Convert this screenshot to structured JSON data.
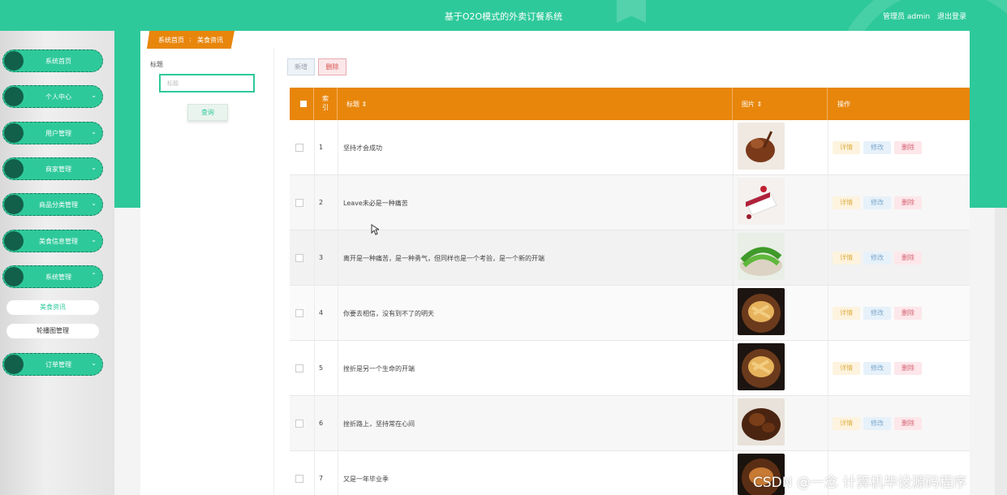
{
  "header": {
    "title": "基于O2O模式的外卖订餐系统",
    "user_label": "管理员 admin",
    "logout_label": "退出登录"
  },
  "sidebar": {
    "items": [
      {
        "label": "系统首页",
        "chevron": ""
      },
      {
        "label": "个人中心",
        "chevron": "⌄"
      },
      {
        "label": "用户管理",
        "chevron": "⌄"
      },
      {
        "label": "商家管理",
        "chevron": "⌄"
      },
      {
        "label": "商品分类管理",
        "chevron": "⌄"
      },
      {
        "label": "美食信息管理",
        "chevron": "⌄"
      },
      {
        "label": "系统管理",
        "chevron": "⌃"
      },
      {
        "label": "订单管理",
        "chevron": "⌄"
      }
    ],
    "subitems": [
      {
        "label": "美食资讯",
        "active": true
      },
      {
        "label": "轮播图管理",
        "active": false
      }
    ]
  },
  "breadcrumb": {
    "home": "系统首页",
    "separator": ":",
    "current": "美食资讯"
  },
  "search": {
    "label": "标题",
    "placeholder": "标题",
    "value": "",
    "button": "查询"
  },
  "toolbar": {
    "add_label": "新增",
    "delete_label": "删除"
  },
  "table": {
    "columns": [
      "索引",
      "标题 ⇕",
      "图片 ⇕",
      "操作"
    ],
    "action_labels": {
      "detail": "详情",
      "edit": "修改",
      "remove": "删除"
    },
    "rows": [
      {
        "index": "1",
        "title": "坚持才会成功",
        "image": "roast-duck"
      },
      {
        "index": "2",
        "title": "Leave未必是一种痛苦",
        "image": "cake-slice"
      },
      {
        "index": "3",
        "title": "离开是一种痛苦，是一种勇气，但同样也是一个考验，是一个新的开端",
        "image": "green-vegetables"
      },
      {
        "index": "4",
        "title": "你要去相信，没有到不了的明天",
        "image": "fried-chicken-feet"
      },
      {
        "index": "5",
        "title": "挫折是另一个生命的开端",
        "image": "fried-chicken-feet"
      },
      {
        "index": "6",
        "title": "挫折路上，坚持常在心间",
        "image": "braised-chicken"
      },
      {
        "index": "7",
        "title": "又是一年毕业季",
        "image": "grilled-wings"
      }
    ]
  },
  "watermark": "CSDN @一念 计算机毕设源码程序",
  "colors": {
    "primary": "#2ec99a",
    "header_orange": "#e8860c",
    "danger": "#d9534f"
  }
}
